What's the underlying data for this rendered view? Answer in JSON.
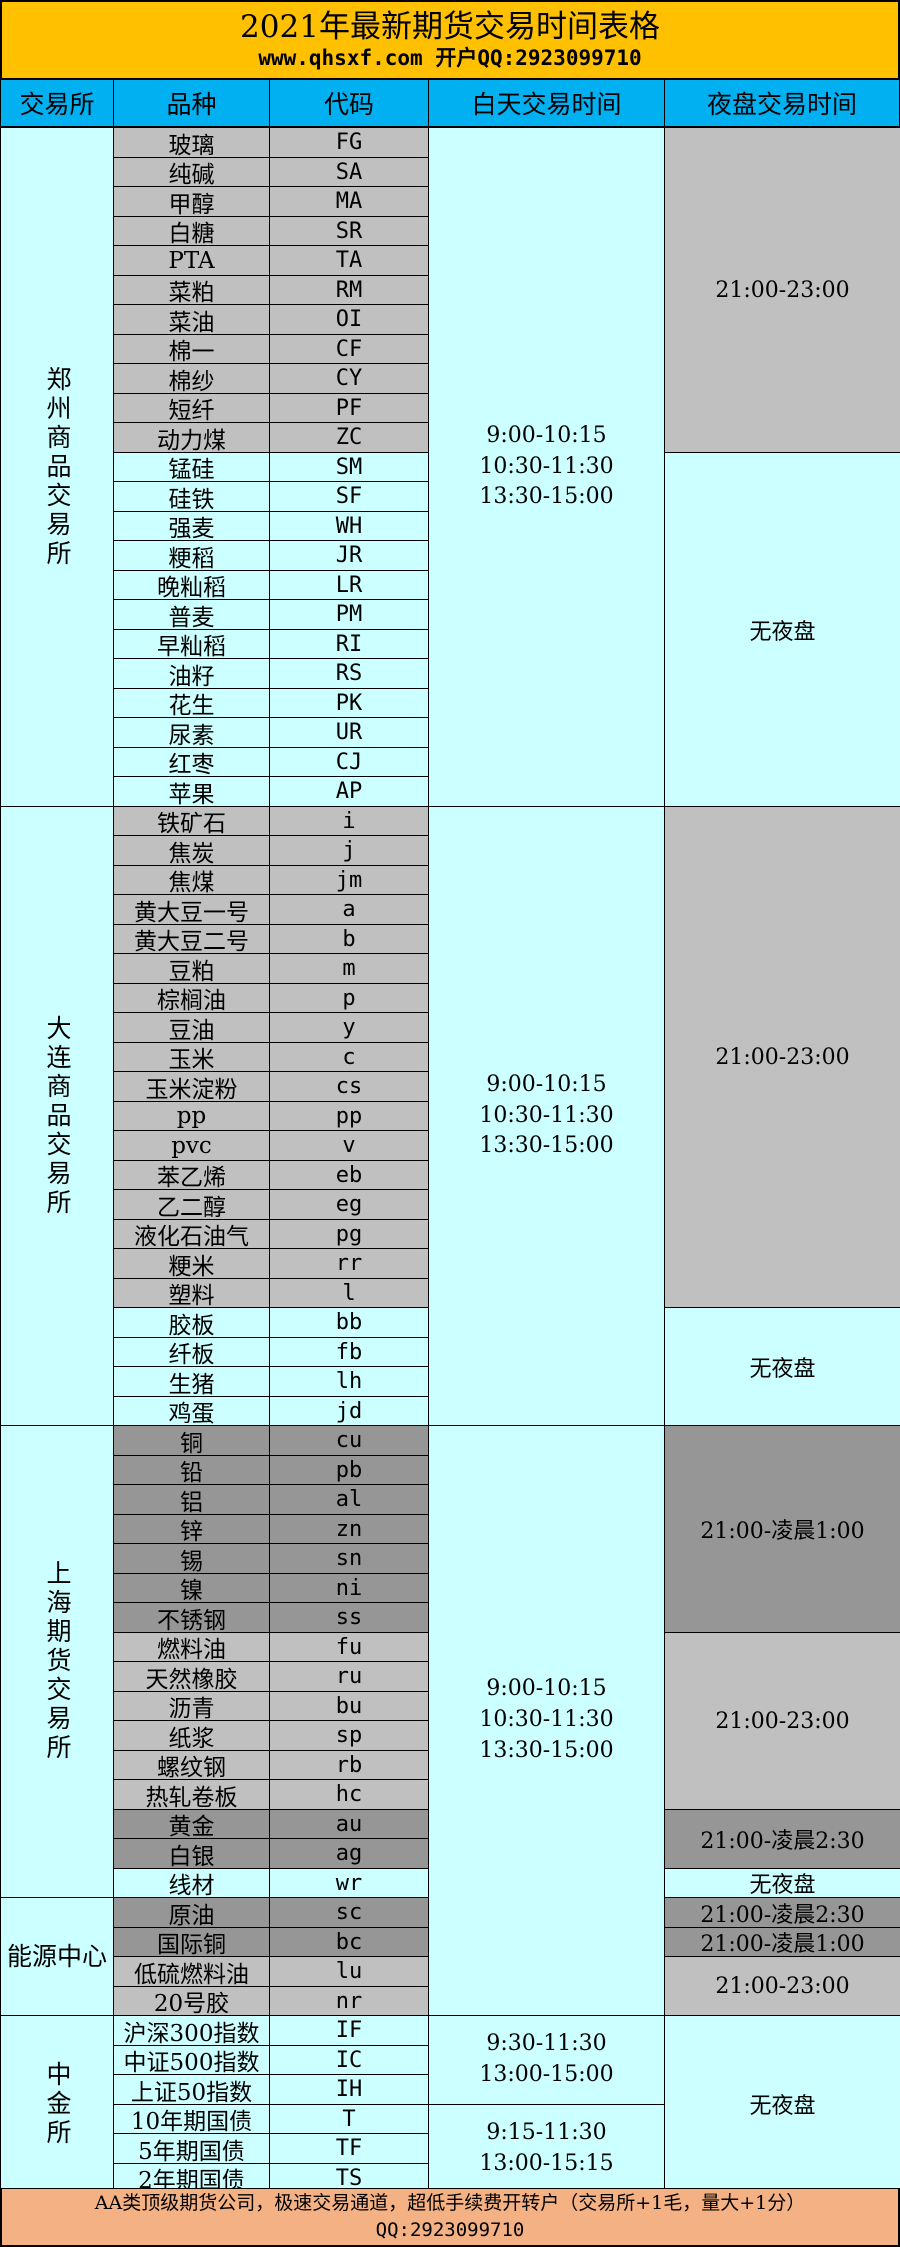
{
  "title": {
    "main": "2021年最新期货交易时间表格",
    "sub": "www.qhsxf.com  开户QQ:2923099710"
  },
  "headers": [
    "交易所",
    "品种",
    "代码",
    "白天交易时间",
    "夜盘交易时间"
  ],
  "colors": {
    "title_bg": "#ffc000",
    "header_bg": "#00b0f0",
    "light_cyan": "#ccffff",
    "light_gray": "#c0c0c0",
    "dark_gray": "#969696",
    "footer_bg": "#f4b183"
  },
  "exchanges": [
    {
      "name": "郑州商品交易所",
      "rows": 23
    },
    {
      "name": "大连商品交易所",
      "rows": 21
    },
    {
      "name": "上海期货交易所",
      "rows": 16
    },
    {
      "name": "能源中心",
      "rows": 4
    },
    {
      "name": "中金所",
      "rows": 6
    }
  ],
  "products": [
    {
      "name": "玻璃",
      "code": "FG",
      "shade": "gray"
    },
    {
      "name": "纯碱",
      "code": "SA",
      "shade": "gray"
    },
    {
      "name": "甲醇",
      "code": "MA",
      "shade": "gray"
    },
    {
      "name": "白糖",
      "code": "SR",
      "shade": "gray"
    },
    {
      "name": "PTA",
      "code": "TA",
      "shade": "gray"
    },
    {
      "name": "菜粕",
      "code": "RM",
      "shade": "gray"
    },
    {
      "name": "菜油",
      "code": "OI",
      "shade": "gray"
    },
    {
      "name": "棉一",
      "code": "CF",
      "shade": "gray"
    },
    {
      "name": "棉纱",
      "code": "CY",
      "shade": "gray"
    },
    {
      "name": "短纤",
      "code": "PF",
      "shade": "gray"
    },
    {
      "name": "动力煤",
      "code": "ZC",
      "shade": "gray"
    },
    {
      "name": "锰硅",
      "code": "SM",
      "shade": "cyan"
    },
    {
      "name": "硅铁",
      "code": "SF",
      "shade": "cyan"
    },
    {
      "name": "强麦",
      "code": "WH",
      "shade": "cyan"
    },
    {
      "name": "粳稻",
      "code": "JR",
      "shade": "cyan"
    },
    {
      "name": "晚籼稻",
      "code": "LR",
      "shade": "cyan"
    },
    {
      "name": "普麦",
      "code": "PM",
      "shade": "cyan"
    },
    {
      "name": "早籼稻",
      "code": "RI",
      "shade": "cyan"
    },
    {
      "name": "油籽",
      "code": "RS",
      "shade": "cyan"
    },
    {
      "name": "花生",
      "code": "PK",
      "shade": "cyan"
    },
    {
      "name": "尿素",
      "code": "UR",
      "shade": "cyan"
    },
    {
      "name": "红枣",
      "code": "CJ",
      "shade": "cyan"
    },
    {
      "name": "苹果",
      "code": "AP",
      "shade": "cyan"
    },
    {
      "name": "铁矿石",
      "code": "i",
      "shade": "gray"
    },
    {
      "name": "焦炭",
      "code": "j",
      "shade": "gray"
    },
    {
      "name": "焦煤",
      "code": "jm",
      "shade": "gray"
    },
    {
      "name": "黄大豆一号",
      "code": "a",
      "shade": "gray"
    },
    {
      "name": "黄大豆二号",
      "code": "b",
      "shade": "gray"
    },
    {
      "name": "豆粕",
      "code": "m",
      "shade": "gray"
    },
    {
      "name": "棕榈油",
      "code": "p",
      "shade": "gray"
    },
    {
      "name": "豆油",
      "code": "y",
      "shade": "gray"
    },
    {
      "name": "玉米",
      "code": "c",
      "shade": "gray"
    },
    {
      "name": "玉米淀粉",
      "code": "cs",
      "shade": "gray"
    },
    {
      "name": "pp",
      "code": "pp",
      "shade": "gray"
    },
    {
      "name": "pvc",
      "code": "v",
      "shade": "gray"
    },
    {
      "name": "苯乙烯",
      "code": "eb",
      "shade": "gray"
    },
    {
      "name": "乙二醇",
      "code": "eg",
      "shade": "gray"
    },
    {
      "name": "液化石油气",
      "code": "pg",
      "shade": "gray"
    },
    {
      "name": "粳米",
      "code": "rr",
      "shade": "gray"
    },
    {
      "name": "塑料",
      "code": "l",
      "shade": "gray"
    },
    {
      "name": "胶板",
      "code": "bb",
      "shade": "cyan"
    },
    {
      "name": "纤板",
      "code": "fb",
      "shade": "cyan"
    },
    {
      "name": "生猪",
      "code": "lh",
      "shade": "cyan"
    },
    {
      "name": "鸡蛋",
      "code": "jd",
      "shade": "cyan"
    },
    {
      "name": "铜",
      "code": "cu",
      "shade": "dark"
    },
    {
      "name": "铅",
      "code": "pb",
      "shade": "dark"
    },
    {
      "name": "铝",
      "code": "al",
      "shade": "dark"
    },
    {
      "name": "锌",
      "code": "zn",
      "shade": "dark"
    },
    {
      "name": "锡",
      "code": "sn",
      "shade": "dark"
    },
    {
      "name": "镍",
      "code": "ni",
      "shade": "dark"
    },
    {
      "name": "不锈钢",
      "code": "ss",
      "shade": "dark"
    },
    {
      "name": "燃料油",
      "code": "fu",
      "shade": "gray"
    },
    {
      "name": "天然橡胶",
      "code": "ru",
      "shade": "gray"
    },
    {
      "name": "沥青",
      "code": "bu",
      "shade": "gray"
    },
    {
      "name": "纸浆",
      "code": "sp",
      "shade": "gray"
    },
    {
      "name": "螺纹钢",
      "code": "rb",
      "shade": "gray"
    },
    {
      "name": "热轧卷板",
      "code": "hc",
      "shade": "gray"
    },
    {
      "name": "黄金",
      "code": "au",
      "shade": "dark"
    },
    {
      "name": "白银",
      "code": "ag",
      "shade": "dark"
    },
    {
      "name": "线材",
      "code": "wr",
      "shade": "cyan"
    },
    {
      "name": "原油",
      "code": "sc",
      "shade": "dark"
    },
    {
      "name": "国际铜",
      "code": "bc",
      "shade": "dark"
    },
    {
      "name": "低硫燃料油",
      "code": "lu",
      "shade": "gray"
    },
    {
      "name": "20号胶",
      "code": "nr",
      "shade": "gray"
    },
    {
      "name": "沪深300指数",
      "code": "IF",
      "shade": "cyan"
    },
    {
      "name": "中证500指数",
      "code": "IC",
      "shade": "cyan"
    },
    {
      "name": "上证50指数",
      "code": "IH",
      "shade": "cyan"
    },
    {
      "name": "10年期国债",
      "code": "T",
      "shade": "cyan"
    },
    {
      "name": "5年期国债",
      "code": "TF",
      "shade": "cyan"
    },
    {
      "name": "2年期国债",
      "code": "TS",
      "shade": "cyan"
    }
  ],
  "day_sessions": [
    {
      "rows": 23,
      "text": "9:00-10:15\n10:30-11:30\n13:30-15:00"
    },
    {
      "rows": 21,
      "text": "9:00-10:15\n10:30-11:30\n13:30-15:00"
    },
    {
      "rows": 20,
      "text": "9:00-10:15\n10:30-11:30\n13:30-15:00"
    },
    {
      "rows": 3,
      "text": "9:30-11:30\n13:00-15:00"
    },
    {
      "rows": 3,
      "text": "9:15-11:30\n13:00-15:15"
    }
  ],
  "night_sessions": [
    {
      "rows": 11,
      "text": "21:00-23:00",
      "shade": "gray"
    },
    {
      "rows": 12,
      "text": "无夜盘",
      "shade": "cyan"
    },
    {
      "rows": 17,
      "text": "21:00-23:00",
      "shade": "gray"
    },
    {
      "rows": 4,
      "text": "无夜盘",
      "shade": "cyan"
    },
    {
      "rows": 7,
      "text": "21:00-凌晨1:00",
      "shade": "dark"
    },
    {
      "rows": 6,
      "text": "21:00-23:00",
      "shade": "gray"
    },
    {
      "rows": 2,
      "text": "21:00-凌晨2:30",
      "shade": "dark"
    },
    {
      "rows": 1,
      "text": "无夜盘",
      "shade": "cyan"
    },
    {
      "rows": 1,
      "text": "21:00-凌晨2:30",
      "shade": "dark"
    },
    {
      "rows": 1,
      "text": "21:00-凌晨1:00",
      "shade": "dark"
    },
    {
      "rows": 2,
      "text": "21:00-23:00",
      "shade": "gray"
    },
    {
      "rows": 6,
      "text": "无夜盘",
      "shade": "cyan"
    }
  ],
  "footer": {
    "line1": "AA类顶级期货公司，极速交易通道，超低手续费开转户（交易所+1毛，量大+1分）",
    "line2": "QQ:2923099710"
  }
}
